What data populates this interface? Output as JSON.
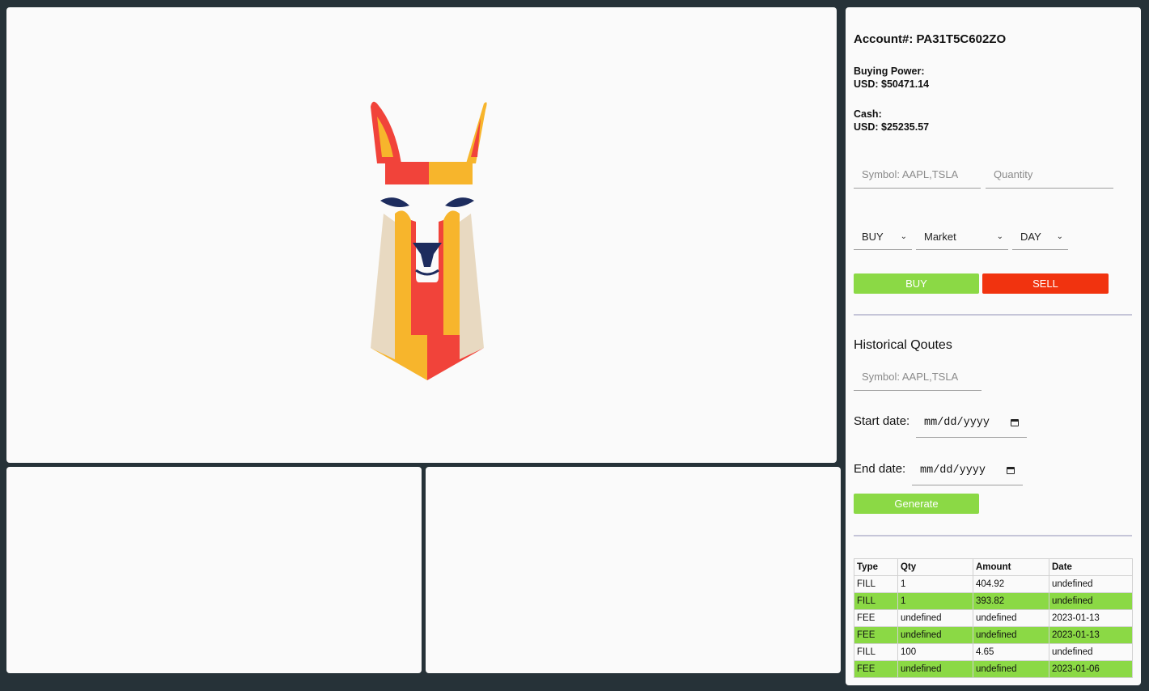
{
  "account": {
    "label": "Account#:",
    "number": "PA31T5C602ZO"
  },
  "buying_power": {
    "label": "Buying Power:",
    "value": "USD: $50471.14"
  },
  "cash": {
    "label": "Cash:",
    "value": "USD: $25235.57"
  },
  "order": {
    "symbol_placeholder": "Symbol: AAPL,TSLA",
    "quantity_placeholder": "Quantity",
    "side": "BUY",
    "type": "Market",
    "tif": "DAY",
    "buy_label": "BUY",
    "sell_label": "SELL"
  },
  "historical": {
    "title": "Historical Qoutes",
    "symbol_placeholder": "Symbol: AAPL,TSLA",
    "start_label": "Start date:",
    "end_label": "End date:",
    "date_placeholder": "mm/dd/yyyy",
    "generate_label": "Generate"
  },
  "transactions": {
    "headers": [
      "Type",
      "Qty",
      "Amount",
      "Date"
    ],
    "rows": [
      [
        "FILL",
        "1",
        "404.92",
        "undefined"
      ],
      [
        "FILL",
        "1",
        "393.82",
        "undefined"
      ],
      [
        "FEE",
        "undefined",
        "undefined",
        "2023-01-13"
      ],
      [
        "FEE",
        "undefined",
        "undefined",
        "2023-01-13"
      ],
      [
        "FILL",
        "100",
        "4.65",
        "undefined"
      ],
      [
        "FEE",
        "undefined",
        "undefined",
        "2023-01-06"
      ]
    ]
  },
  "colors": {
    "buy": "#8bd945",
    "sell": "#f1330f",
    "background": "#263238"
  },
  "logo": "llama-logo"
}
